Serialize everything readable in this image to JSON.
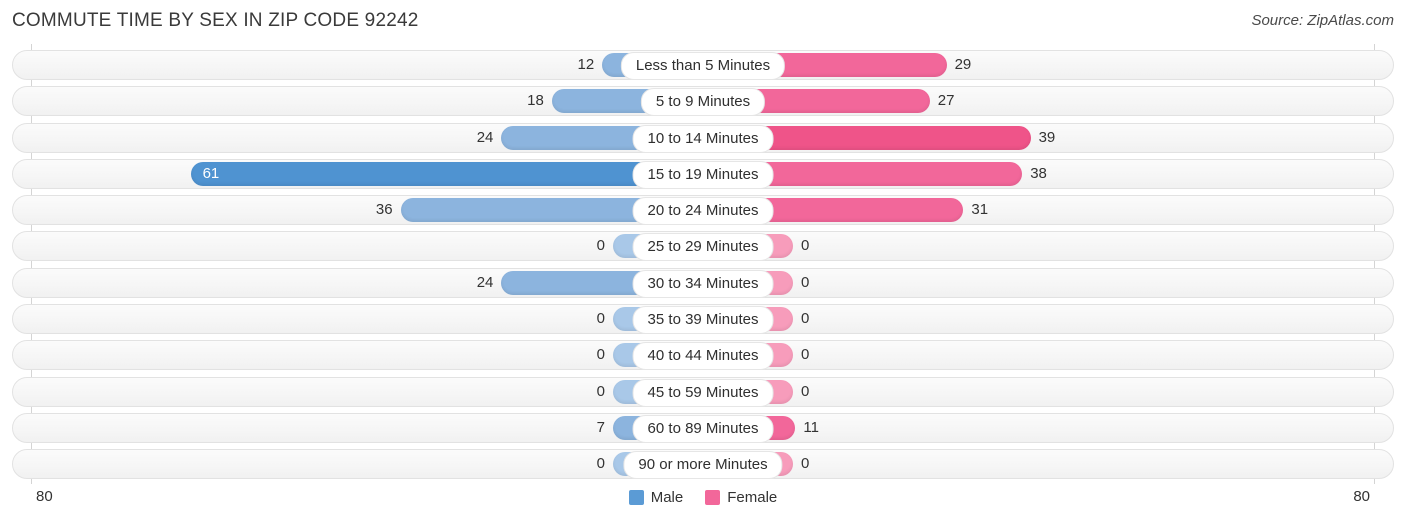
{
  "header": {
    "title": "COMMUTE TIME BY SEX IN ZIP CODE 92242",
    "source": "Source: ZipAtlas.com"
  },
  "axis": {
    "left_tick": "80",
    "right_tick": "80",
    "max": 80
  },
  "legend": {
    "items": [
      {
        "label": "Male",
        "color": "#5b9bd5"
      },
      {
        "label": "Female",
        "color": "#f2679a"
      }
    ]
  },
  "colors": {
    "male": "#8cb4de",
    "male_zero": "#a9c8e8",
    "male_max": "#4f93d1",
    "female": "#f2679a",
    "female_zero": "#f79cbb",
    "female_max": "#ef5489",
    "track": "#f5f5f5"
  },
  "chart_data": {
    "type": "bar",
    "title": "COMMUTE TIME BY SEX IN ZIP CODE 92242",
    "subtitle": "Source: ZipAtlas.com",
    "orientation": "horizontal-diverging",
    "xlabel": "",
    "ylabel": "",
    "xlim": [
      0,
      80
    ],
    "grid": false,
    "legend_position": "bottom-center",
    "categories": [
      "Less than 5 Minutes",
      "5 to 9 Minutes",
      "10 to 14 Minutes",
      "15 to 19 Minutes",
      "20 to 24 Minutes",
      "25 to 29 Minutes",
      "30 to 34 Minutes",
      "35 to 39 Minutes",
      "40 to 44 Minutes",
      "45 to 59 Minutes",
      "60 to 89 Minutes",
      "90 or more Minutes"
    ],
    "series": [
      {
        "name": "Male",
        "side": "left",
        "values": [
          12,
          18,
          24,
          61,
          36,
          0,
          24,
          0,
          0,
          0,
          7,
          0
        ]
      },
      {
        "name": "Female",
        "side": "right",
        "values": [
          29,
          27,
          39,
          38,
          31,
          0,
          0,
          0,
          0,
          0,
          11,
          0
        ]
      }
    ]
  },
  "rows": [
    {
      "label": "Less than 5 Minutes",
      "male": "12",
      "female": "29"
    },
    {
      "label": "5 to 9 Minutes",
      "male": "18",
      "female": "27"
    },
    {
      "label": "10 to 14 Minutes",
      "male": "24",
      "female": "39"
    },
    {
      "label": "15 to 19 Minutes",
      "male": "61",
      "female": "38"
    },
    {
      "label": "20 to 24 Minutes",
      "male": "36",
      "female": "31"
    },
    {
      "label": "25 to 29 Minutes",
      "male": "0",
      "female": "0"
    },
    {
      "label": "30 to 34 Minutes",
      "male": "24",
      "female": "0"
    },
    {
      "label": "35 to 39 Minutes",
      "male": "0",
      "female": "0"
    },
    {
      "label": "40 to 44 Minutes",
      "male": "0",
      "female": "0"
    },
    {
      "label": "45 to 59 Minutes",
      "male": "0",
      "female": "0"
    },
    {
      "label": "60 to 89 Minutes",
      "male": "7",
      "female": "11"
    },
    {
      "label": "90 or more Minutes",
      "male": "0",
      "female": "0"
    }
  ]
}
